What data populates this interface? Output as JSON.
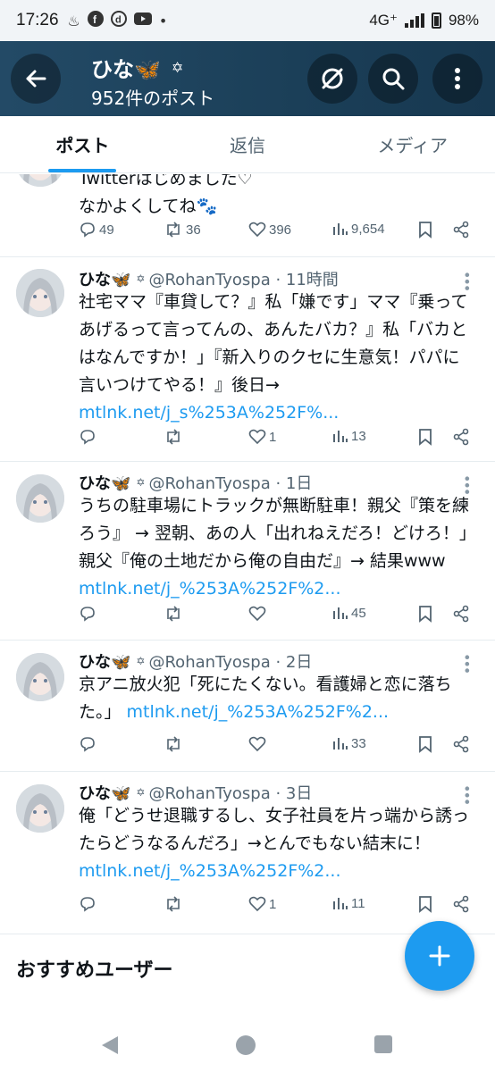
{
  "status_bar": {
    "time": "17:26",
    "network": "4G⁺",
    "battery": "98%"
  },
  "header": {
    "name": "ひな🦋",
    "post_count": "952件のポスト",
    "back_icon": "arrow-left-icon",
    "accent_color": "#1d9bf0"
  },
  "tabs": [
    {
      "label": "ポスト",
      "active": true
    },
    {
      "label": "返信",
      "active": false
    },
    {
      "label": "メディア",
      "active": false
    }
  ],
  "first_post_partial": {
    "text_line1": "Twitterはじめました♡",
    "text_line2": "なかよくしてね🐾",
    "replies": "49",
    "reposts": "36",
    "likes": "396",
    "views": "9,654"
  },
  "posts": [
    {
      "name": "ひな🦋",
      "meta": "@RohanTyospa · 11時間",
      "text": "社宅ママ『車貸して？』私「嫌です」ママ『乗ってあげるって言ってんの、あんたバカ？』私「バカとはなんですか！」『新入りのクセに生意気！パパに言いつけてやる！』後日→ ",
      "link": "mtlnk.net/j_s%253A%252F%...",
      "replies": "",
      "reposts": "",
      "likes": "1",
      "views": "13"
    },
    {
      "name": "ひな🦋",
      "meta": "@RohanTyospa · 1日",
      "text": "うちの駐車場にトラックが無断駐車！親父『策を練ろう』 → 翌朝、あの人「出れねえだろ！どけろ！」親父『俺の土地だから俺の自由だ』→ 結果www ",
      "link": "mtlnk.net/j_%253A%252F%2...",
      "replies": "",
      "reposts": "",
      "likes": "",
      "views": "45"
    },
    {
      "name": "ひな🦋",
      "meta": "@RohanTyospa · 2日",
      "text": "京アニ放火犯「死にたくない。看護婦と恋に落ちた。」 ",
      "link": "mtlnk.net/j_%253A%252F%2...",
      "replies": "",
      "reposts": "",
      "likes": "",
      "views": "33"
    },
    {
      "name": "ひな🦋",
      "meta": "@RohanTyospa · 3日",
      "text": "俺「どうせ退職するし、女子社員を片っ端から誘ったらどうなるんだろ」→とんでもない結末に！ ",
      "link": "mtlnk.net/j_%253A%252F%2...",
      "replies": "",
      "reposts": "",
      "likes": "1",
      "views": "11"
    }
  ],
  "recommended_title": "おすすめユーザー"
}
